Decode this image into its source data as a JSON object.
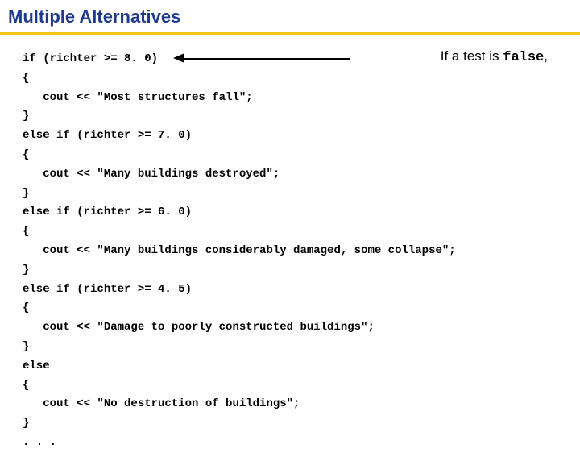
{
  "title": "Multiple Alternatives",
  "code": {
    "l1": "if (richter >= 8. 0)",
    "l2": "{",
    "l3": "   cout << \"Most structures fall\";",
    "l4": "}",
    "l5": "else if (richter >= 7. 0)",
    "l6": "{",
    "l7": "   cout << \"Many buildings destroyed\";",
    "l8": "}",
    "l9": "else if (richter >= 6. 0)",
    "l10": "{",
    "l11": "   cout << \"Many buildings considerably damaged, some collapse\";",
    "l12": "}",
    "l13": "else if (richter >= 4. 5)",
    "l14": "{",
    "l15": "   cout << \"Damage to poorly constructed buildings\";",
    "l16": "}",
    "l17": "else",
    "l18": "{",
    "l19": "   cout << \"No destruction of buildings\";",
    "l20": "}",
    "l21": ". . ."
  },
  "annotation": {
    "prefix": "If a test is ",
    "mono": "false",
    "suffix": ","
  }
}
